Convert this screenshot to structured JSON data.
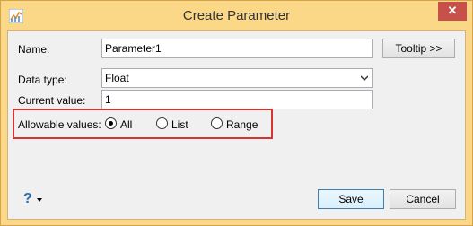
{
  "window": {
    "title": "Create Parameter",
    "close_label": "✕"
  },
  "form": {
    "name_label": "Name:",
    "name_value": "Parameter1",
    "tooltip_button": "Tooltip >>",
    "data_type_label": "Data type:",
    "data_type_value": "Float",
    "current_value_label": "Current value:",
    "current_value": "1",
    "allowable_label": "Allowable values:",
    "allowable_options": [
      "All",
      "List",
      "Range"
    ],
    "allowable_selected": "All"
  },
  "footer": {
    "help_symbol": "?",
    "save_prefix": "",
    "save_underline": "S",
    "save_rest": "ave",
    "cancel_underline": "C",
    "cancel_rest": "ancel"
  },
  "colors": {
    "titlebar": "#fbd788",
    "close_button": "#c7504b",
    "highlight_border": "#d63333"
  }
}
